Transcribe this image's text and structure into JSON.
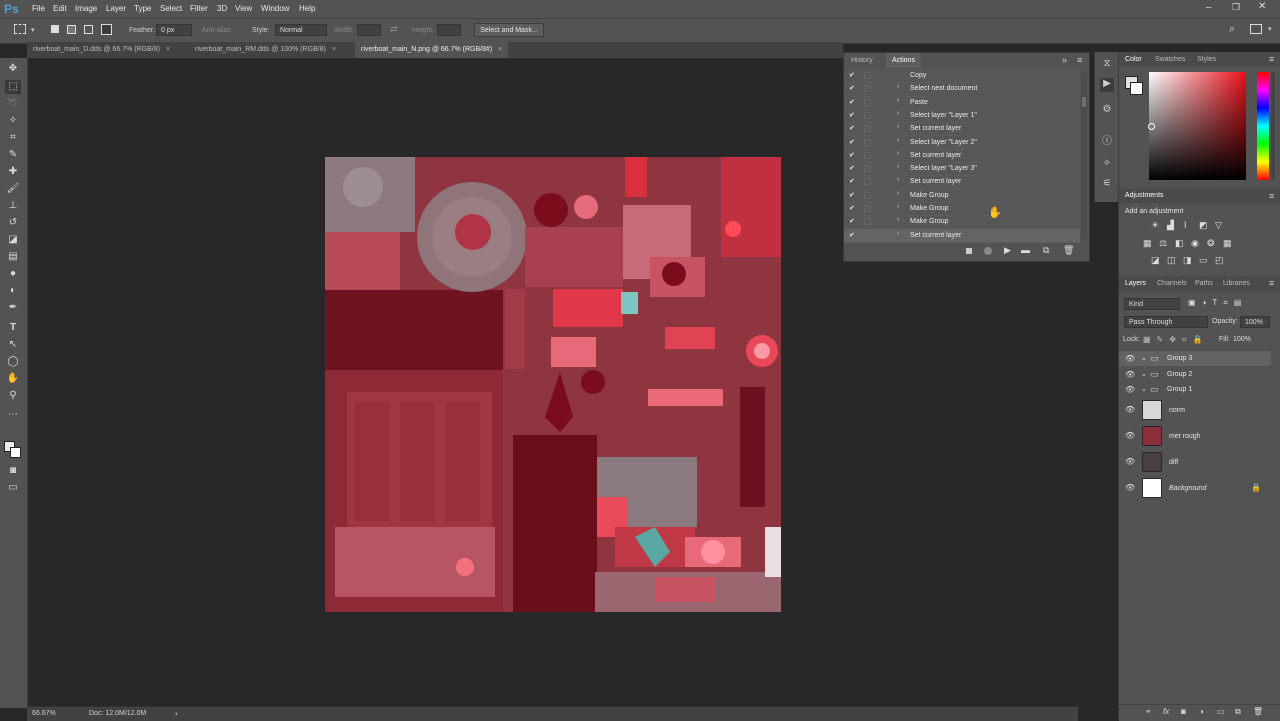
{
  "app": {
    "logo": "Ps"
  },
  "menu": [
    "File",
    "Edit",
    "Image",
    "Layer",
    "Type",
    "Select",
    "Filter",
    "3D",
    "View",
    "Window",
    "Help"
  ],
  "options": {
    "feather_label": "Feather:",
    "feather_value": "0 px",
    "antialias_label": "Anti-alias",
    "style_label": "Style:",
    "style_value": "Normal",
    "width_label": "Width:",
    "height_label": "Height:",
    "select_mask_label": "Select and Mask..."
  },
  "doc_tabs": [
    {
      "label": "riverboat_main_D.dds @ 66.7% (RGB/8)",
      "close": "×"
    },
    {
      "label": "riverboat_main_RM.dds @ 100% (RGB/8)",
      "close": "×"
    },
    {
      "label": "riverboat_main_N.png @ 66.7% (RGB/8#)",
      "close": "×"
    }
  ],
  "actions_panel": {
    "tabs": [
      "History",
      "Actions"
    ],
    "items": [
      {
        "label": "Copy",
        "expandable": false
      },
      {
        "label": "Select next document",
        "expandable": true
      },
      {
        "label": "Paste",
        "expandable": true
      },
      {
        "label": "Select layer \"Layer 1\"",
        "expandable": true
      },
      {
        "label": "Set current layer",
        "expandable": true
      },
      {
        "label": "Select layer \"Layer 2\"",
        "expandable": true
      },
      {
        "label": "Set current layer",
        "expandable": true
      },
      {
        "label": "Select layer \"Layer 3\"",
        "expandable": true
      },
      {
        "label": "Set current layer",
        "expandable": true
      },
      {
        "label": "Make Group",
        "expandable": true
      },
      {
        "label": "Make Group",
        "expandable": true
      },
      {
        "label": "Make Group",
        "expandable": true
      },
      {
        "label": "Set current layer",
        "expandable": true
      }
    ]
  },
  "color_panel": {
    "tabs": [
      "Color",
      "Swatches",
      "Styles"
    ]
  },
  "adjustments_panel": {
    "title": "Adjustments",
    "subtitle": "Add an adjustment"
  },
  "layers_panel": {
    "tabs": [
      "Layers",
      "Channels",
      "Paths",
      "Libraries"
    ],
    "kind_label": "Kind",
    "blend_mode": "Pass Through",
    "opacity_label": "Opacity:",
    "opacity_value": "100%",
    "lock_label": "Lock:",
    "fill_label": "Fill:",
    "fill_value": "100%",
    "layers": [
      {
        "name": "Group 3",
        "type": "group",
        "selected": true
      },
      {
        "name": "Group 2",
        "type": "group"
      },
      {
        "name": "Group 1",
        "type": "group"
      },
      {
        "name": "norm",
        "type": "image"
      },
      {
        "name": "met rough",
        "type": "image"
      },
      {
        "name": "diff",
        "type": "image"
      },
      {
        "name": "Background",
        "type": "background",
        "locked": true
      }
    ]
  },
  "status": {
    "zoom": "66.67%",
    "doc": "Doc: 12.0M/12.0M"
  }
}
